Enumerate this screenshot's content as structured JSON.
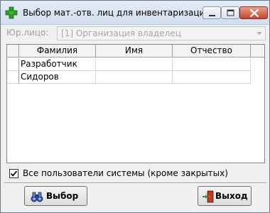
{
  "window": {
    "title": "Выбор мат.-отв. лиц для инвентаризации",
    "app_icon": "green-plus-icon",
    "controls": [
      "minimize-icon",
      "maximize-icon",
      "close-icon"
    ]
  },
  "org": {
    "label": "Юр.лицо:",
    "value": "[1] Организация владелец",
    "dropdown_icon": "chevron-down-icon"
  },
  "grid": {
    "columns": [
      "Фамилия",
      "Имя",
      "Отчество"
    ],
    "rows": [
      [
        "Разработчик",
        "",
        ""
      ],
      [
        "Сидоров",
        "",
        ""
      ]
    ]
  },
  "options": {
    "all_users_label": "Все пользователи системы (кроме закрытых)",
    "all_users_checked": true
  },
  "buttons": {
    "select_label": "Выбор",
    "select_icon": "binoculars-icon",
    "exit_label": "Выход",
    "exit_icon": "exit-door-icon"
  },
  "colors": {
    "title_bar": "#dbe5f1",
    "close_button": "#c5452f",
    "disabled_text": "#a0a0a0"
  }
}
